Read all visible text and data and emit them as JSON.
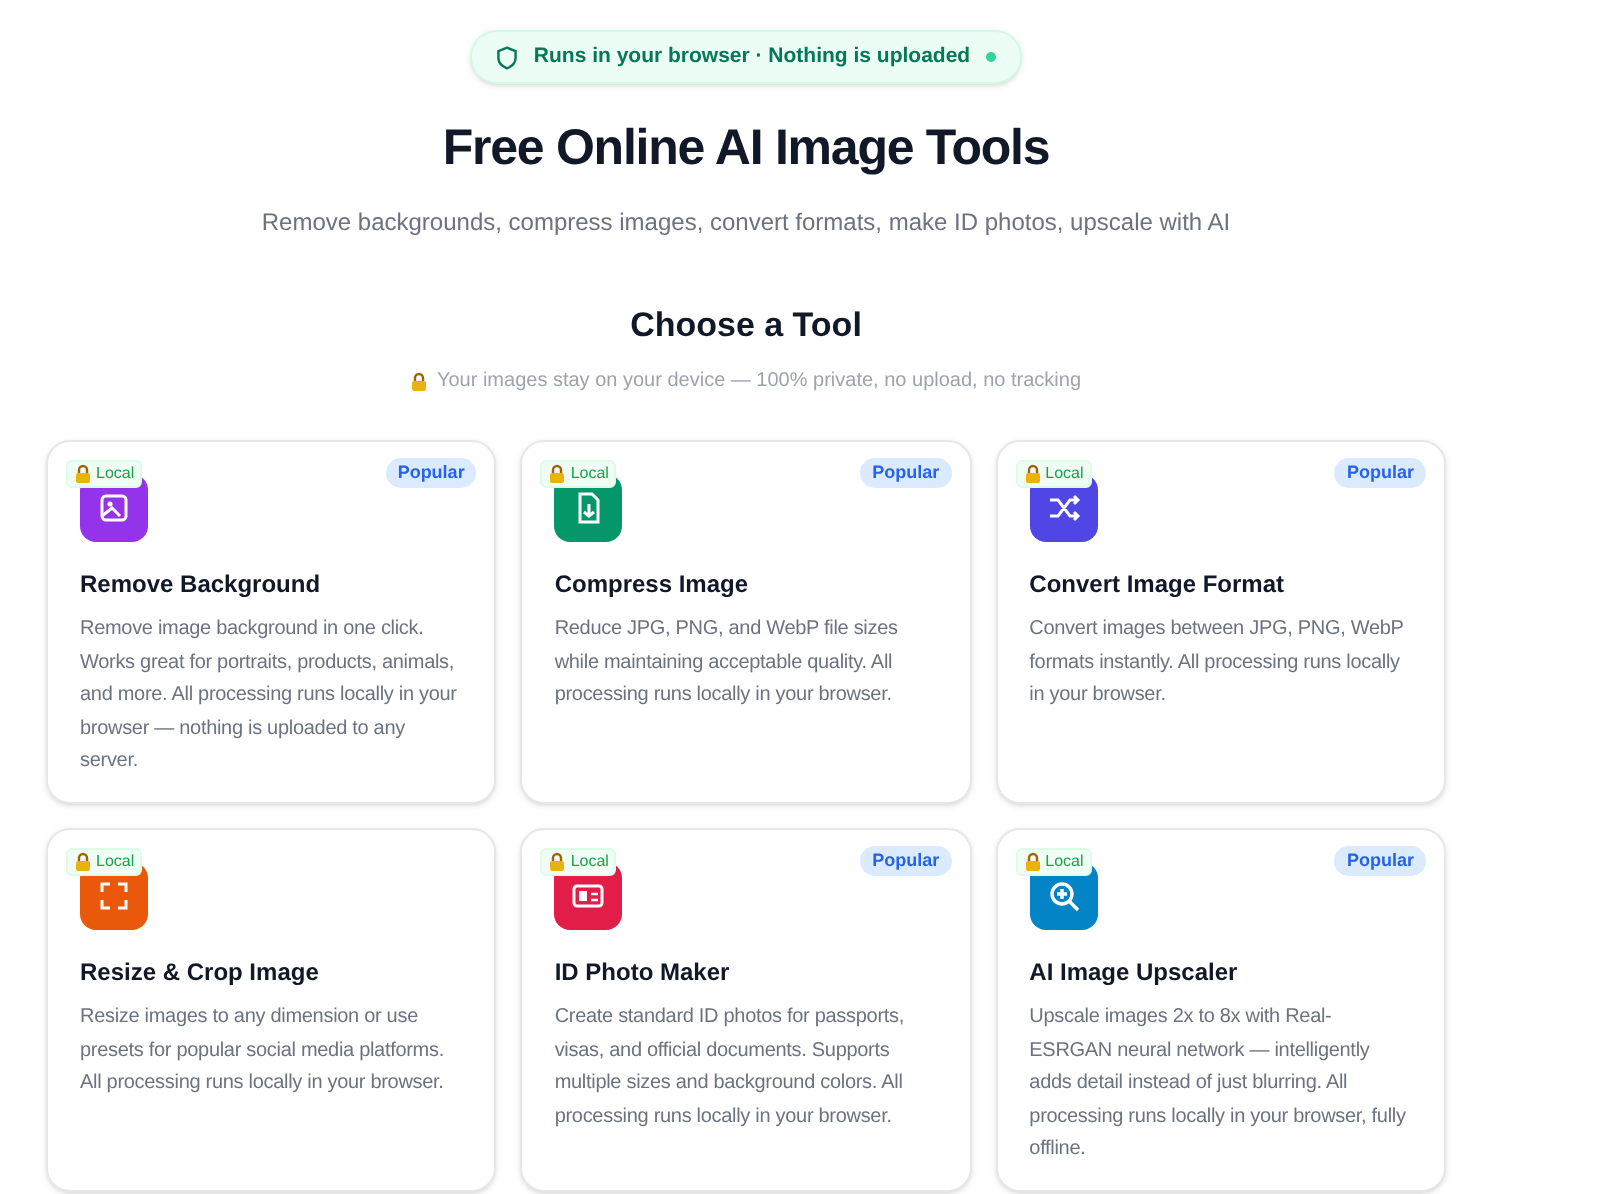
{
  "banner": {
    "text": "Runs in your browser · Nothing is uploaded"
  },
  "hero": {
    "title": "Free Online AI Image Tools",
    "subtitle": "Remove backgrounds, compress images, convert formats, make ID photos, upscale with AI"
  },
  "section": {
    "title": "Choose a Tool",
    "note": "Your images stay on your device — 100% private, no upload, no tracking"
  },
  "tools": [
    {
      "title": "Remove Background",
      "description": "Remove image background in one click. Works great for portraits, products, animals, and more. All processing runs locally in your browser — nothing is uploaded to any server.",
      "badge": "Local",
      "tag": "Popular",
      "kind": "image",
      "color": "#9333ea"
    },
    {
      "title": "Compress Image",
      "description": "Reduce JPG, PNG, and WebP file sizes while maintaining acceptable quality. All processing runs locally in your browser.",
      "badge": "Local",
      "tag": "Popular",
      "kind": "file",
      "color": "#059669"
    },
    {
      "title": "Convert Image Format",
      "description": "Convert images between JPG, PNG, WebP formats instantly. All processing runs locally in your browser.",
      "badge": "Local",
      "tag": "Popular",
      "kind": "shuffle",
      "color": "#4f46e5"
    },
    {
      "title": "Resize & Crop Image",
      "description": "Resize images to any dimension or use presets for popular social media platforms. All processing runs locally in your browser.",
      "badge": "Local",
      "kind": "crop",
      "color": "#ea580c"
    },
    {
      "title": "ID Photo Maker",
      "description": "Create standard ID photos for passports, visas, and official documents. Supports multiple sizes and background colors. All processing runs locally in your browser.",
      "badge": "Local",
      "tag": "Popular",
      "kind": "idcard",
      "color": "#e11d48"
    },
    {
      "title": "AI Image Upscaler",
      "description": "Upscale images 2x to 8x with Real-ESRGAN neural network — intelligently adds detail instead of just blurring. All processing runs locally in your browser, fully offline.",
      "badge": "Local",
      "tag": "Popular",
      "kind": "zoom",
      "color": "#0284c7"
    }
  ]
}
